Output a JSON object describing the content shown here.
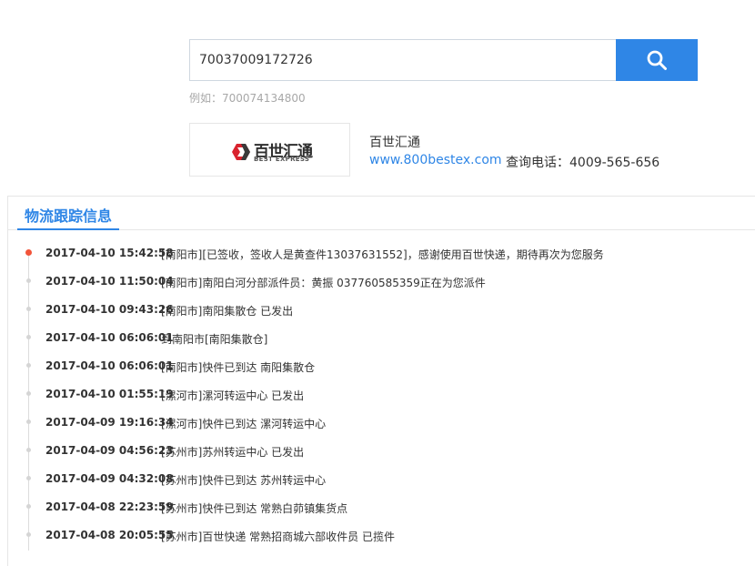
{
  "search": {
    "value": "70037009172726",
    "example": "例如：700074134800"
  },
  "carrier": {
    "logo_cn": "百世汇通",
    "logo_en": "BEST EXPRESS",
    "name": "百世汇通",
    "website": "www.800bestex.com",
    "phone_label": "查询电话：",
    "phone": "4009-565-656"
  },
  "panel": {
    "title": "物流跟踪信息"
  },
  "events": [
    {
      "time": "2017-04-10 15:42:58",
      "desc": "[南阳市][已签收，签收人是黄查件13037631552]，感谢使用百世快递，期待再次为您服务"
    },
    {
      "time": "2017-04-10 11:50:04",
      "desc": "[南阳市]南阳白河分部派件员：黄振 037760585359正在为您派件"
    },
    {
      "time": "2017-04-10 09:43:26",
      "desc": "[南阳市]南阳集散仓 已发出"
    },
    {
      "time": "2017-04-10 06:06:01",
      "desc": "到南阳市[南阳集散仓]"
    },
    {
      "time": "2017-04-10 06:06:01",
      "desc": "[南阳市]快件已到达 南阳集散仓"
    },
    {
      "time": "2017-04-10 01:55:19",
      "desc": "[漯河市]漯河转运中心 已发出"
    },
    {
      "time": "2017-04-09 19:16:34",
      "desc": "[漯河市]快件已到达 漯河转运中心"
    },
    {
      "time": "2017-04-09 04:56:23",
      "desc": "[苏州市]苏州转运中心 已发出"
    },
    {
      "time": "2017-04-09 04:32:08",
      "desc": "[苏州市]快件已到达 苏州转运中心"
    },
    {
      "time": "2017-04-08 22:23:59",
      "desc": "[苏州市]快件已到达 常熟白茆镇集货点"
    },
    {
      "time": "2017-04-08 20:05:55",
      "desc": "[苏州市]百世快递 常熟招商城六部收件员 已揽件"
    }
  ],
  "colors": {
    "accent": "#2f86e6",
    "active_dot": "#f2543a",
    "logo_red": "#d9232e"
  },
  "icons": {
    "search": "search-icon",
    "logo": "best-express-logo"
  }
}
